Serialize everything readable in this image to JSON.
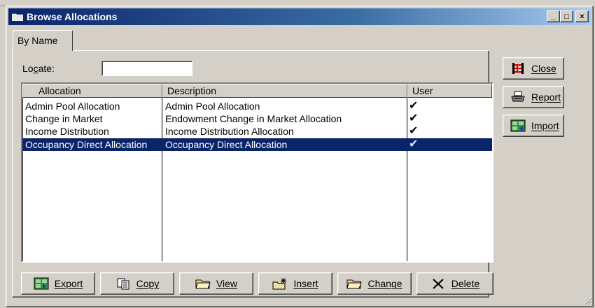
{
  "window": {
    "title": "Browse Allocations",
    "controls": {
      "minimize": "_",
      "maximize": "□",
      "close": "×"
    }
  },
  "tabs": [
    {
      "label": "By Name",
      "selected": true
    }
  ],
  "locate": {
    "label": "Locate:",
    "value": "",
    "placeholder": ""
  },
  "list": {
    "columns": [
      "Allocation",
      "Description",
      "User"
    ],
    "rows": [
      {
        "allocation": "Admin Pool Allocation",
        "description": "Admin Pool Allocation",
        "user": "✔",
        "selected": false
      },
      {
        "allocation": "Change in Market",
        "description": "Endowment Change in Market Allocation",
        "user": "✔",
        "selected": false
      },
      {
        "allocation": "Income Distribution",
        "description": "Income Distribution Allocation",
        "user": "✔",
        "selected": false
      },
      {
        "allocation": "Occupancy Direct Allocation",
        "description": "Occupancy Direct Allocation",
        "user": "✔",
        "selected": true
      }
    ]
  },
  "side_buttons": {
    "close": {
      "label": "Close",
      "icon": "close-gate-icon"
    },
    "report": {
      "label": "Report",
      "icon": "printer-icon"
    },
    "import": {
      "label": "Import",
      "icon": "import-icon"
    }
  },
  "bottom_buttons": {
    "export": {
      "label": "Export",
      "icon": "export-icon"
    },
    "copy": {
      "label": "Copy",
      "icon": "copy-icon"
    },
    "view": {
      "label": "View",
      "icon": "folder-view-icon"
    },
    "insert": {
      "label": "Insert",
      "icon": "insert-folder-icon"
    },
    "change": {
      "label": "Change",
      "icon": "folder-change-icon"
    },
    "delete": {
      "label": "Delete",
      "icon": "delete-x-icon"
    }
  },
  "colors": {
    "title_bar_start": "#0a246a",
    "title_bar_end": "#a6caf0",
    "selection": "#0a246a",
    "face": "#d4d0c8"
  }
}
